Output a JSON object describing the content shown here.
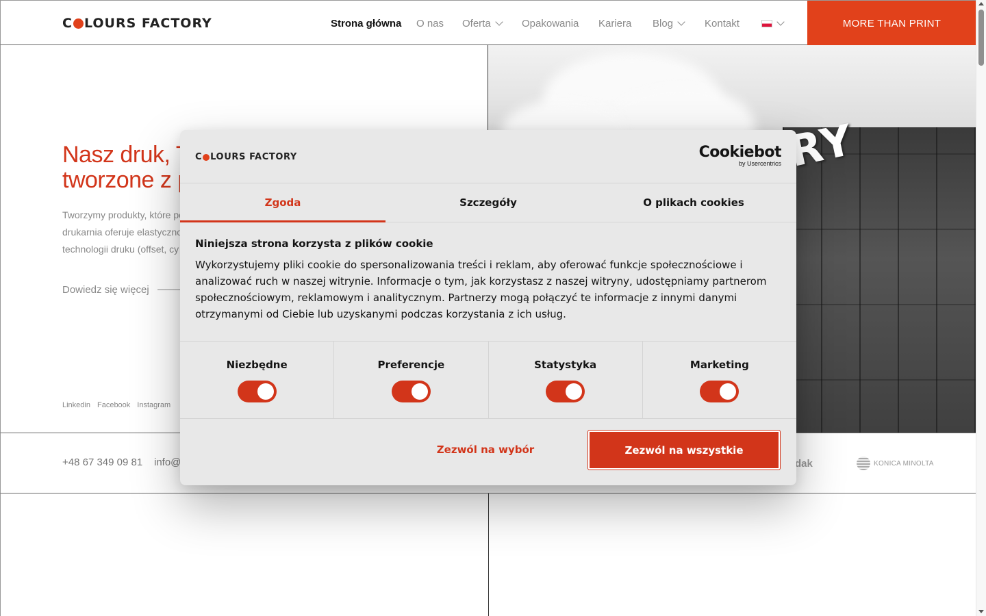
{
  "brand": {
    "logo_part1": "C",
    "logo_part2": "LOURS FACTORY",
    "accent_color": "#e1411b"
  },
  "nav": {
    "items": [
      {
        "label": "Strona główna",
        "active": true
      },
      {
        "label": "O nas"
      },
      {
        "label": "Oferta",
        "dropdown": true
      },
      {
        "label": "Opakowania"
      },
      {
        "label": "Kariera"
      },
      {
        "label": "Blog",
        "dropdown": true
      },
      {
        "label": "Kontakt"
      }
    ],
    "language_icon": "poland-flag-icon",
    "cta_label": "MORE THAN PRINT"
  },
  "hero": {
    "title_line1": "Nasz druk, Tw",
    "title_line2": "tworzone z pa",
    "text_line1": "Tworzymy produkty, które po",
    "text_line2": "drukarnia oferuje elastyczno",
    "text_line3": "technologii druku (offset, cy",
    "more_label": "Dowiedz się więcej",
    "building_sign": "RY",
    "socials": [
      "Linkedin",
      "Facebook",
      "Instagram"
    ]
  },
  "contact": {
    "phone": "+48 67 349 09 81",
    "email": "info@c",
    "partners": [
      "dak",
      "KONICA MINOLTA"
    ]
  },
  "cookie_dialog": {
    "logo_part1": "C",
    "logo_part2": "LOURS FACTORY",
    "provider_name": "Cookiebot",
    "provider_sub": "by Usercentrics",
    "tabs": [
      {
        "label": "Zgoda",
        "active": true
      },
      {
        "label": "Szczegóły"
      },
      {
        "label": "O plikach cookies"
      }
    ],
    "heading": "Niniejsza strona korzysta z plików cookie",
    "body": "Wykorzystujemy pliki cookie do spersonalizowania treści i reklam, aby oferować funkcje społecznościowe i analizować ruch w naszej witrynie. Informacje o tym, jak korzystasz z naszej witryny, udostępniamy partnerom społecznościowym, reklamowym i analitycznym. Partnerzy mogą połączyć te informacje z innymi danymi otrzymanymi od Ciebie lub uzyskanymi podczas korzystania z ich usług.",
    "toggles": [
      {
        "label": "Niezbędne",
        "on": true
      },
      {
        "label": "Preferencje",
        "on": true
      },
      {
        "label": "Statystyka",
        "on": true
      },
      {
        "label": "Marketing",
        "on": true
      }
    ],
    "allow_selection_label": "Zezwól na wybór",
    "allow_all_label": "Zezwól na wszystkie",
    "accent_color": "#d2351a"
  }
}
